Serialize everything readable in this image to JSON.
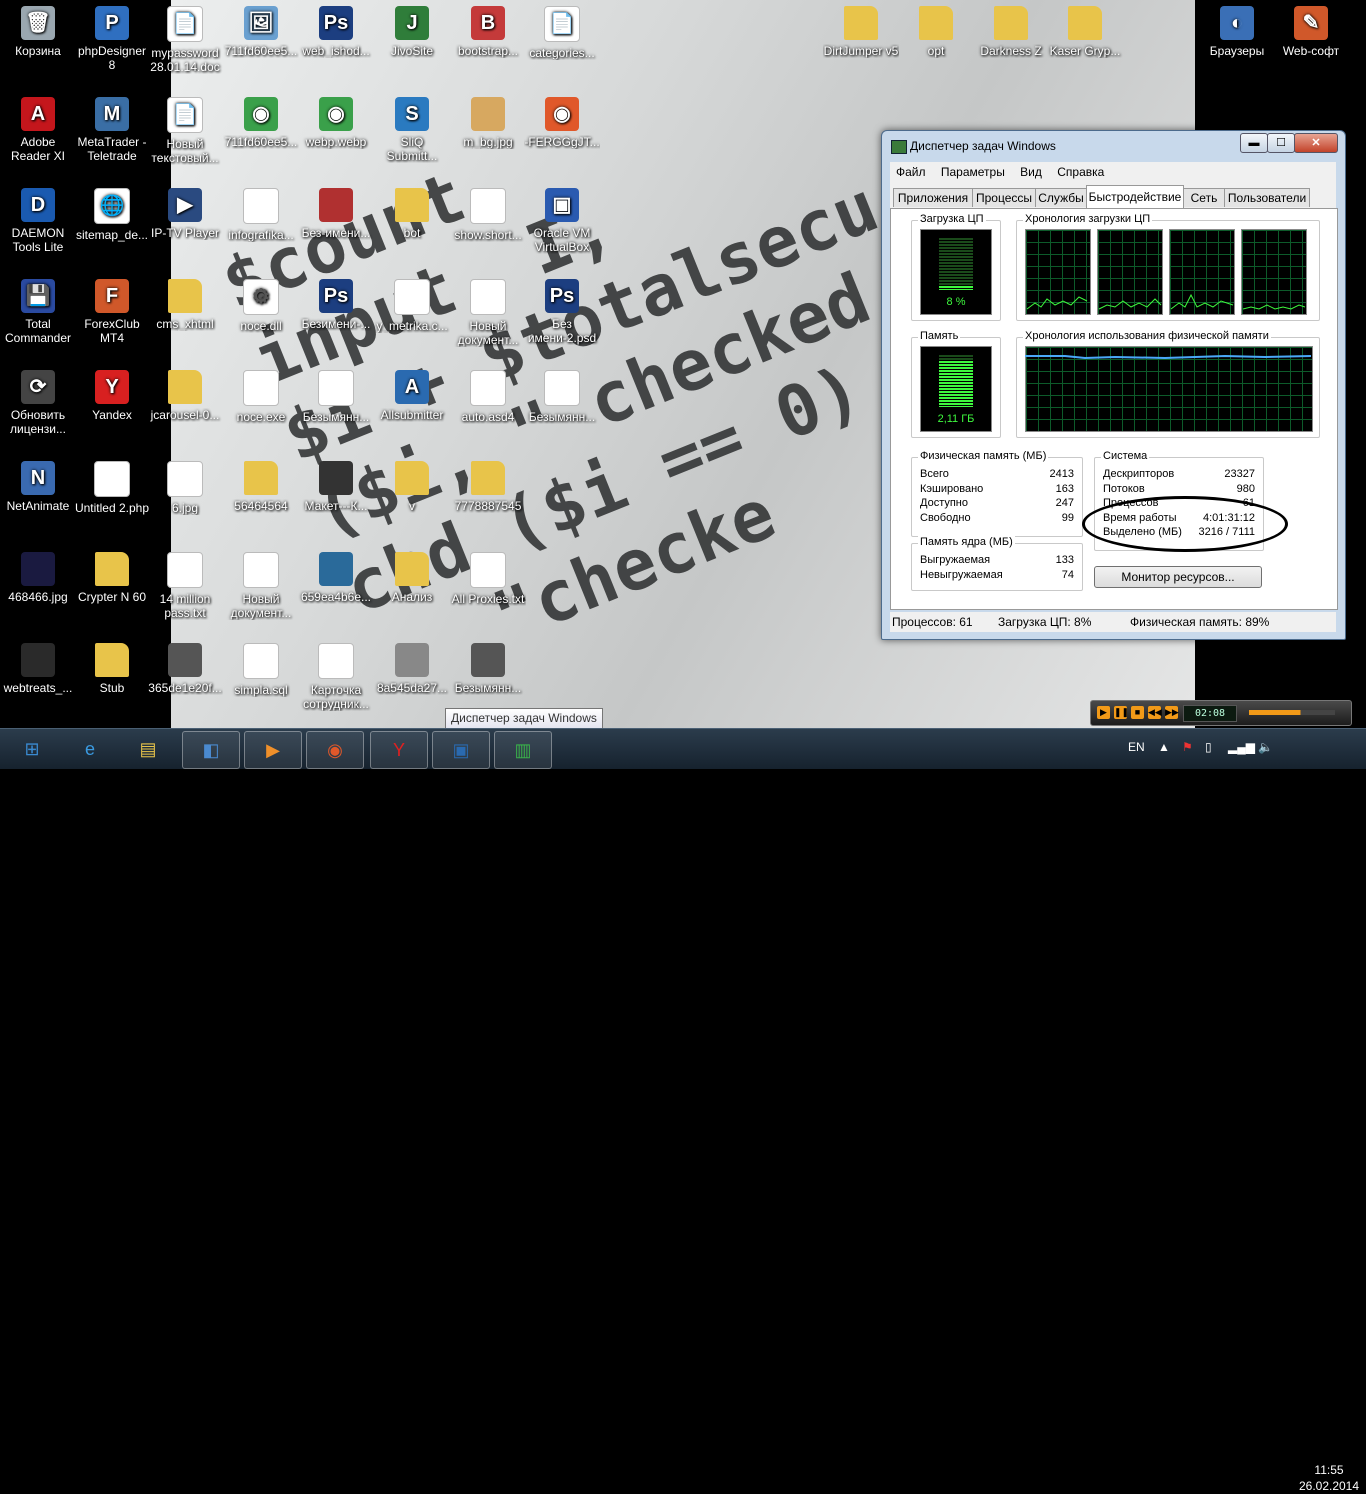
{
  "desktop": {
    "icons": [
      {
        "label": "Корзина",
        "icon": "recycle-bin-icon",
        "color": "#9aa7b0",
        "glyph": "🗑"
      },
      {
        "label": "phpDesigner 8",
        "icon": "phpdesigner-icon",
        "color": "#2f6fc0",
        "glyph": "P"
      },
      {
        "label": "mypassword 28.01.14.doc",
        "icon": "document-icon",
        "color": "#ffffff",
        "glyph": "📄"
      },
      {
        "label": "711fd60ee5...",
        "icon": "image-file-icon",
        "color": "#6aa0d0",
        "glyph": "🖼"
      },
      {
        "label": "web_ishod...",
        "icon": "psd-file-icon",
        "color": "#1c3e80",
        "glyph": "Ps"
      },
      {
        "label": "JivoSite",
        "icon": "jivosite-icon",
        "color": "#2f7d3a",
        "glyph": "J"
      },
      {
        "label": "bootstrap...",
        "icon": "archive-icon",
        "color": "#c43a3a",
        "glyph": "B"
      },
      {
        "label": "categories...",
        "icon": "text-file-icon",
        "color": "#ffffff",
        "glyph": "📄"
      },
      {
        "label": "DirtJumper v5",
        "icon": "folder-icon",
        "color": "#e8c44a",
        "glyph": ""
      },
      {
        "label": "opt",
        "icon": "folder-icon",
        "color": "#e8c44a",
        "glyph": ""
      },
      {
        "label": "Darkness Z",
        "icon": "folder-icon",
        "color": "#e8c44a",
        "glyph": ""
      },
      {
        "label": "Kaser Gryp...",
        "icon": "folder-icon",
        "color": "#e8c44a",
        "glyph": ""
      },
      {
        "label": "Браузеры",
        "icon": "browsers-icon",
        "color": "#3a6fb6",
        "glyph": "◐"
      },
      {
        "label": "Web-софт",
        "icon": "tools-icon",
        "color": "#d0582a",
        "glyph": "✎"
      },
      {
        "label": "Adobe Reader XI",
        "icon": "adobe-reader-icon",
        "color": "#c4161c",
        "glyph": "A"
      },
      {
        "label": "MetaTrader - Teletrade",
        "icon": "metatrader-icon",
        "color": "#3a6ea5",
        "glyph": "M"
      },
      {
        "label": "Новый текстовый...",
        "icon": "text-file-icon",
        "color": "#ffffff",
        "glyph": "📄"
      },
      {
        "label": "711fd60ee5...",
        "icon": "chrome-icon",
        "color": "#3aa04a",
        "glyph": "◉"
      },
      {
        "label": "webp.webp",
        "icon": "chrome-icon",
        "color": "#3aa04a",
        "glyph": "◉"
      },
      {
        "label": "SliQ Submitt...",
        "icon": "sliq-icon",
        "color": "#2a7ac0",
        "glyph": "S"
      },
      {
        "label": "m_bg.jpg",
        "icon": "image-file-icon",
        "color": "#d7a860",
        "glyph": ""
      },
      {
        "label": "-FERGGgJT...",
        "icon": "firefox-image-icon",
        "color": "#e0582a",
        "glyph": "◉"
      },
      {
        "label": "DAEMON Tools Lite",
        "icon": "daemon-tools-icon",
        "color": "#1a5ab0",
        "glyph": "D"
      },
      {
        "label": "sitemap_de...",
        "icon": "web-file-icon",
        "color": "#ffffff",
        "glyph": "🌐"
      },
      {
        "label": "IP-TV Player",
        "icon": "iptv-icon",
        "color": "#2a4a80",
        "glyph": "▶"
      },
      {
        "label": "infografika...",
        "icon": "image-file-icon",
        "color": "#ffffff",
        "glyph": ""
      },
      {
        "label": "Без-имени...",
        "icon": "image-file-icon",
        "color": "#b03030",
        "glyph": ""
      },
      {
        "label": "bot",
        "icon": "folder-icon",
        "color": "#e8c44a",
        "glyph": ""
      },
      {
        "label": "show.short...",
        "icon": "document-icon",
        "color": "#ffffff",
        "glyph": ""
      },
      {
        "label": "Oracle VM VirtualBox",
        "icon": "virtualbox-icon",
        "color": "#2a5ab0",
        "glyph": "▣"
      },
      {
        "label": "Total Commander",
        "icon": "total-commander-icon",
        "color": "#2a4aa0",
        "glyph": "💾"
      },
      {
        "label": "ForexClub MT4",
        "icon": "forexclub-icon",
        "color": "#d0582a",
        "glyph": "F"
      },
      {
        "label": "cms_xhtml",
        "icon": "folder-icon",
        "color": "#e8c44a",
        "glyph": ""
      },
      {
        "label": "noce.dll",
        "icon": "dll-file-icon",
        "color": "#ffffff",
        "glyph": "⚙"
      },
      {
        "label": "Безимени-...",
        "icon": "psd-file-icon",
        "color": "#1c3e80",
        "glyph": "Ps"
      },
      {
        "label": "y_metrika.c...",
        "icon": "text-file-icon",
        "color": "#ffffff",
        "glyph": ""
      },
      {
        "label": "Новый документ...",
        "icon": "document-icon",
        "color": "#ffffff",
        "glyph": ""
      },
      {
        "label": "Без имени-2.psd",
        "icon": "psd-file-icon",
        "color": "#1c3e80",
        "glyph": "Ps"
      },
      {
        "label": "Обновить лицензи...",
        "icon": "update-license-icon",
        "color": "#444444",
        "glyph": "⟳"
      },
      {
        "label": "Yandex",
        "icon": "yandex-icon",
        "color": "#d82020",
        "glyph": "Y"
      },
      {
        "label": "jcarousel-0...",
        "icon": "folder-icon",
        "color": "#e8c44a",
        "glyph": ""
      },
      {
        "label": "noce.exe",
        "icon": "exe-file-icon",
        "color": "#ffffff",
        "glyph": ""
      },
      {
        "label": "Безымянн...",
        "icon": "image-file-icon",
        "color": "#ffffff",
        "glyph": ""
      },
      {
        "label": "Allsubmitter",
        "icon": "allsubmitter-icon",
        "color": "#2a6ab0",
        "glyph": "A"
      },
      {
        "label": "auto.asd4",
        "icon": "blank-file-icon",
        "color": "#ffffff",
        "glyph": ""
      },
      {
        "label": "Безымянн...",
        "icon": "image-file-icon",
        "color": "#ffffff",
        "glyph": ""
      },
      {
        "label": "NetAnimate",
        "icon": "netanimate-icon",
        "color": "#3a6ab0",
        "glyph": "N"
      },
      {
        "label": "Untitled 2.php",
        "icon": "php-file-icon",
        "color": "#ffffff",
        "glyph": ""
      },
      {
        "label": "6.jpg",
        "icon": "image-file-icon",
        "color": "#ffffff",
        "glyph": ""
      },
      {
        "label": "56464564",
        "icon": "folder-icon",
        "color": "#e8c44a",
        "glyph": ""
      },
      {
        "label": "Макет---К...",
        "icon": "image-file-icon",
        "color": "#333333",
        "glyph": ""
      },
      {
        "label": "v",
        "icon": "folder-icon",
        "color": "#e8c44a",
        "glyph": ""
      },
      {
        "label": "7778887545",
        "icon": "folder-icon",
        "color": "#e8c44a",
        "glyph": ""
      },
      {
        "label": "468466.jpg",
        "icon": "image-file-icon",
        "color": "#1a1a40",
        "glyph": ""
      },
      {
        "label": "Crypter N 60",
        "icon": "folder-icon",
        "color": "#e8c44a",
        "glyph": ""
      },
      {
        "label": "14 million pass.txt",
        "icon": "text-file-icon",
        "color": "#ffffff",
        "glyph": ""
      },
      {
        "label": "Новый документ...",
        "icon": "document-icon",
        "color": "#ffffff",
        "glyph": ""
      },
      {
        "label": "659ea4b6e...",
        "icon": "image-file-icon",
        "color": "#2a6a9a",
        "glyph": ""
      },
      {
        "label": "Анализ",
        "icon": "folder-icon",
        "color": "#e8c44a",
        "glyph": ""
      },
      {
        "label": "All Proxies.txt",
        "icon": "text-file-icon",
        "color": "#ffffff",
        "glyph": ""
      },
      {
        "label": "webtreats_...",
        "icon": "image-file-icon",
        "color": "#2a2a2a",
        "glyph": ""
      },
      {
        "label": "Stub",
        "icon": "folder-icon",
        "color": "#e8c44a",
        "glyph": ""
      },
      {
        "label": "365de1e20f...",
        "icon": "image-file-icon",
        "color": "#555555",
        "glyph": ""
      },
      {
        "label": "simpla.sql",
        "icon": "blank-file-icon",
        "color": "#ffffff",
        "glyph": ""
      },
      {
        "label": "Карточка сотрудник...",
        "icon": "docx-file-icon",
        "color": "#ffffff",
        "glyph": ""
      },
      {
        "label": "8a545da27...",
        "icon": "image-file-icon",
        "color": "#888888",
        "glyph": ""
      },
      {
        "label": "Безымянн...",
        "icon": "image-file-icon",
        "color": "#555555",
        "glyph": ""
      }
    ]
  },
  "task_manager": {
    "title": "Диспетчер задач Windows",
    "window_buttons": {
      "minimize": "▬",
      "maximize": "☐",
      "close": "✕"
    },
    "menu": [
      "Файл",
      "Параметры",
      "Вид",
      "Справка"
    ],
    "tabs": [
      "Приложения",
      "Процессы",
      "Службы",
      "Быстродействие",
      "Сеть",
      "Пользователи"
    ],
    "active_tab": "Быстродействие",
    "cpu": {
      "label": "Загрузка ЦП",
      "value": "8 %",
      "percent": 8
    },
    "cpu_history": {
      "label": "Хронология загрузки ЦП",
      "cores": 4
    },
    "memory": {
      "label": "Память",
      "value": "2,11 ГБ",
      "percent": 89
    },
    "memory_history": {
      "label": "Хронология использования физической памяти"
    },
    "physical_memory": {
      "label": "Физическая память (МБ)",
      "rows": [
        {
          "name": "Всего",
          "value": "2413"
        },
        {
          "name": "Кэшировано",
          "value": "163"
        },
        {
          "name": "Доступно",
          "value": "247"
        },
        {
          "name": "Свободно",
          "value": "99"
        }
      ]
    },
    "kernel_memory": {
      "label": "Память ядра (МБ)",
      "rows": [
        {
          "name": "Выгружаемая",
          "value": "133"
        },
        {
          "name": "Невыгружаемая",
          "value": "74"
        }
      ]
    },
    "system": {
      "label": "Система",
      "rows": [
        {
          "name": "Дескрипторов",
          "value": "23327"
        },
        {
          "name": "Потоков",
          "value": "980"
        },
        {
          "name": "Процессов",
          "value": "61"
        },
        {
          "name": "Время работы",
          "value": "4:01:31:12"
        },
        {
          "name": "Выделено (МБ)",
          "value": "3216 / 7111"
        }
      ]
    },
    "resource_monitor_button": "Монитор ресурсов...",
    "status": {
      "processes": "Процессов: 61",
      "cpu": "Загрузка ЦП: 8%",
      "memory": "Физическая память: 89%"
    }
  },
  "tooltip": "Диспетчер задач Windows",
  "media_player": {
    "time": "02:08"
  },
  "taskbar": {
    "items": [
      {
        "name": "start-button",
        "glyph": "⊞",
        "color": "#3a8ad0"
      },
      {
        "name": "internet-explorer-icon",
        "glyph": "e",
        "color": "#3a9ae0"
      },
      {
        "name": "file-explorer-icon",
        "glyph": "▤",
        "color": "#e8c44a"
      },
      {
        "name": "windows-app-icon",
        "glyph": "◧",
        "color": "#4a8ad0"
      },
      {
        "name": "media-player-icon",
        "glyph": "▶",
        "color": "#f0902a"
      },
      {
        "name": "firefox-icon",
        "glyph": "◉",
        "color": "#e0582a"
      },
      {
        "name": "yandex-browser-icon",
        "glyph": "Y",
        "color": "#e02020"
      },
      {
        "name": "virtualbox-icon",
        "glyph": "▣",
        "color": "#2a6ab0"
      },
      {
        "name": "task-manager-icon",
        "glyph": "▥",
        "color": "#3ab04a"
      }
    ],
    "language": "EN",
    "time": "11:55",
    "date": "26.02.2014"
  }
}
